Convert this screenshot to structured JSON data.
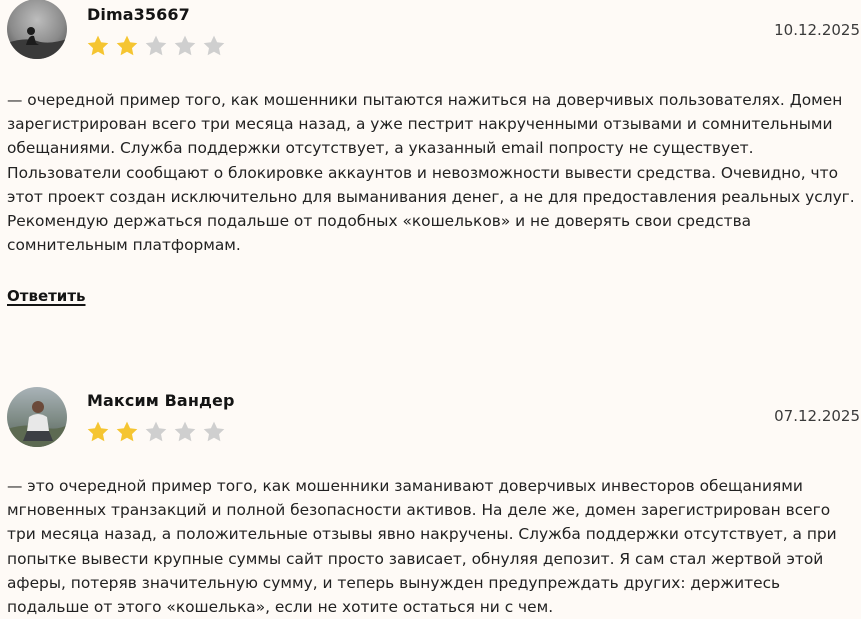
{
  "reviews": [
    {
      "author": "Dima35667",
      "date": "10.12.2025",
      "rating": 2,
      "max_rating": 5,
      "text": "— очередной пример того, как мошенники пытаются нажиться на доверчивых пользователях. Домен зарегистрирован всего три месяца назад, а уже пестрит накрученными отзывами и сомнительными обещаниями. Служба поддержки отсутствует, а указанный email попросту не существует. Пользователи сообщают о блокировке аккаунтов и невозможности вывести средства. Очевидно, что этот проект создан исключительно для выманивания денег, а не для предоставления реальных услуг. Рекомендую держаться подальше от подобных «кошельков» и не доверять свои средства сомнительным платформам.",
      "reply_label": "Ответить"
    },
    {
      "author": "Максим Вандер",
      "date": "07.12.2025",
      "rating": 2,
      "max_rating": 5,
      "text": "— это очередной пример того, как мошенники заманивают доверчивых инвесторов обещаниями мгновенных транзакций и полной безопасности активов. На деле же, домен зарегистрирован всего три месяца назад, а положительные отзывы явно накручены. Служба поддержки отсутствует, а при попытке вывести крупные суммы сайт просто зависает, обнуляя депозит. Я сам стал жертвой этой аферы, потеряв значительную сумму, и теперь вынужден предупреждать других: держитесь подальше от этого «кошелька», если не хотите остаться ни с чем."
    }
  ],
  "colors": {
    "background": "#fefaf6",
    "star_filled": "#f5c531",
    "star_empty": "#cfcfcf"
  },
  "icons": {
    "star": "star-icon",
    "avatar": "avatar-photo"
  }
}
